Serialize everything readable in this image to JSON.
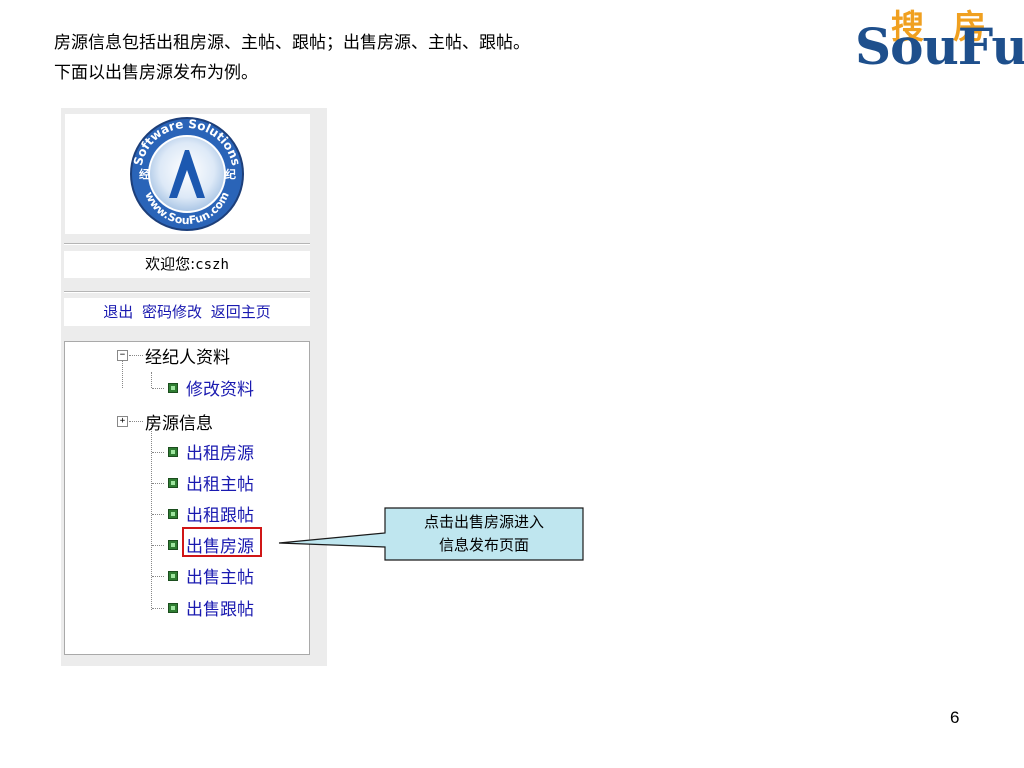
{
  "intro": {
    "line1": "房源信息包括出租房源、主帖、跟帖；出售房源、主帖、跟帖。",
    "line2": "下面以出售房源发布为例。"
  },
  "brand": {
    "cn_char1": "搜",
    "cn_char2": "房",
    "en": "SouFun"
  },
  "badge": {
    "top_arc": "Software Solutions",
    "bottom_arc": "www.SouFun.com",
    "left_char": "经",
    "right_char": "纪"
  },
  "welcome": {
    "label": "欢迎您:",
    "username": "cszh"
  },
  "links": {
    "logout": "退出",
    "change_password": "密码修改",
    "home": "返回主页"
  },
  "tree": {
    "expander_minus": "−",
    "expander_plus": "+",
    "group1": {
      "label": "经纪人资料",
      "items": [
        "修改资料"
      ]
    },
    "group2": {
      "label": "房源信息",
      "items": [
        "出租房源",
        "出租主帖",
        "出租跟帖",
        "出售房源",
        "出售主帖",
        "出售跟帖"
      ]
    }
  },
  "callout": {
    "line1": "点击出售房源进入",
    "line2": "信息发布页面"
  },
  "page_number": "6",
  "colors": {
    "link": "#1a1ab0",
    "highlight": "#d01616",
    "callout_fill": "#bfe6ef",
    "brand_orange": "#f0a020",
    "brand_blue": "#1e4f8c"
  }
}
